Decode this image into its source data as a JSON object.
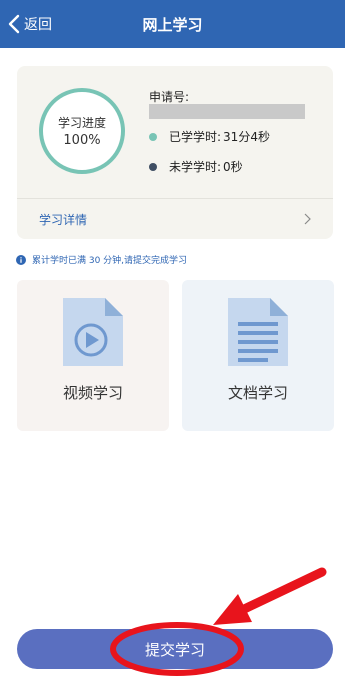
{
  "header": {
    "back_label": "返回",
    "title": "网上学习"
  },
  "progress": {
    "ring_title": "学习进度",
    "percent_text": "100%",
    "percent": 100,
    "application_label": "申请号:",
    "studied_label": "已学学时:",
    "studied_value": "31分4秒",
    "remaining_label": "未学学时:",
    "remaining_value": "0秒",
    "detail_link": "学习详情"
  },
  "notice": {
    "text": "累计学时已满 30 分钟,请提交完成学习"
  },
  "tiles": [
    {
      "label": "视频学习",
      "icon": "video-file-icon"
    },
    {
      "label": "文档学习",
      "icon": "document-file-icon"
    }
  ],
  "submit": {
    "label": "提交学习"
  },
  "colors": {
    "brand": "#2f66b3",
    "ring": "#78c4b5",
    "studied_dot": "#78c4b5",
    "remaining_dot": "#3f4e63",
    "annotation": "#e8141c"
  }
}
